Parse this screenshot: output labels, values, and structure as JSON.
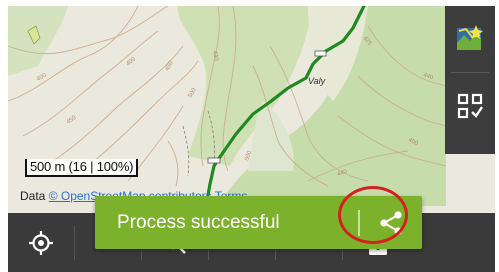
{
  "map": {
    "place_label": "Valy",
    "contour_labels": [
      "400",
      "450",
      "400",
      "450",
      "500",
      "430",
      "440",
      "425",
      "400",
      "440",
      "500"
    ]
  },
  "scale": {
    "label": "500 m (16 | 100%)"
  },
  "attribution": {
    "prefix": "Data ",
    "link_text": "© OpenStreetMap contributors",
    "terms": "Terms"
  },
  "toast": {
    "message": "Process successful"
  },
  "icons": {
    "right_toolbar": [
      "map-layers-icon",
      "dashboard-grid-icon"
    ],
    "bottom_bar": [
      "gps-locate-icon",
      "rotate-icon",
      "search-icon",
      "tools-icon",
      "lock-icon"
    ],
    "toast": "share-icon"
  },
  "colors": {
    "route": "#1f8a1f",
    "toast_bg": "#7cb22b",
    "highlight": "#d42020",
    "bar_bg": "#3a3a3a"
  }
}
